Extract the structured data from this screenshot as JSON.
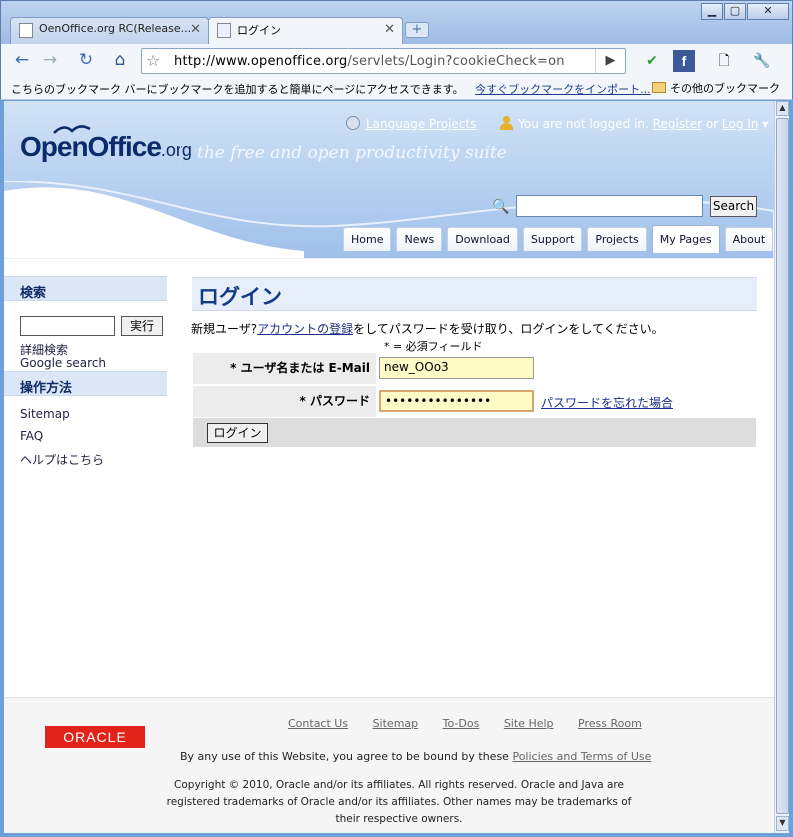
{
  "browser": {
    "tabs": [
      {
        "label": "OenOffice.org RC(Release..."
      },
      {
        "label": "ログイン"
      }
    ],
    "url": {
      "host": "http://www.openoffice.org",
      "path": "/servlets/Login?cookieCheck=on"
    },
    "bookmark_bar": {
      "message": "こちらのブックマーク バーにブックマークを追加すると簡単にページにアクセスできます。",
      "import_link": "今すぐブックマークをインポート...",
      "other_bookmarks": "その他のブックマーク"
    }
  },
  "header": {
    "logo_main": "OpenOffice",
    "logo_suffix": ".org",
    "tagline": "the free and open productivity suite",
    "language_projects": "Language Projects",
    "login_status": "You are not logged in.",
    "register": "Register",
    "or": "or",
    "login": "Log In",
    "login_arrow": "▾",
    "search_button": "Search",
    "nav": [
      "Home",
      "News",
      "Download",
      "Support",
      "Projects",
      "My Pages",
      "About"
    ],
    "active_nav": "My Pages"
  },
  "sidebar": {
    "search_title": "検索",
    "search_button": "実行",
    "advanced_search": "詳細検索",
    "google_search": "Google search",
    "howto_title": "操作方法",
    "links": [
      "Sitemap",
      "FAQ",
      "ヘルプはこちら"
    ]
  },
  "main": {
    "title": "ログイン",
    "intro_prefix": "新規ユーザ?",
    "intro_link": "アカウントの登録",
    "intro_suffix": "をしてパスワードを受け取り、ログインをしてください。",
    "required_note": "* = 必須フィールド",
    "username_label": "* ユーザ名または E-Mail",
    "username_value": "new_OOo3",
    "password_label": "* パスワード",
    "password_value": "•••••••••••••••",
    "forgot_password": "パスワードを忘れた場合",
    "login_button": "ログイン"
  },
  "footer": {
    "oracle": "ORACLE",
    "links": [
      "Contact Us",
      "Sitemap",
      "To-Dos",
      "Site Help",
      "Press Room"
    ],
    "terms_prefix": "By any use of this Website, you agree to be bound by these ",
    "terms_link": "Policies and Terms of Use",
    "copyright": "Copyright © 2010, Oracle and/or its affiliates. All rights reserved. Oracle and Java are registered trademarks of Oracle and/or its affiliates. Other names may be trademarks of their respective owners."
  }
}
